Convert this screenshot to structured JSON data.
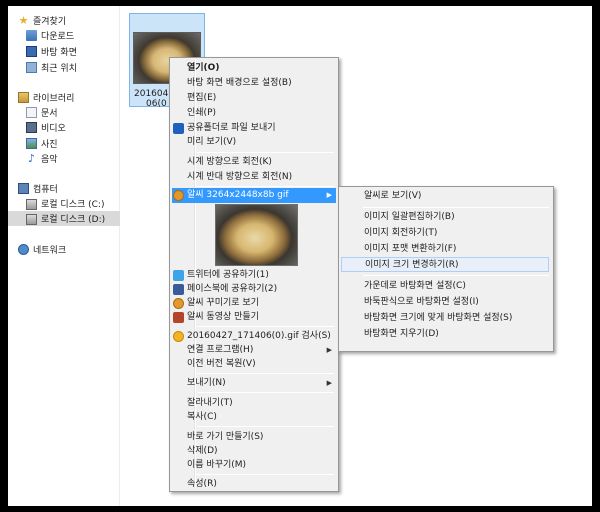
{
  "nav": {
    "favorites": {
      "label": "즐겨찾기",
      "items": [
        "다운로드",
        "바탕 화면",
        "최근 위치"
      ]
    },
    "libraries": {
      "label": "라이브러리",
      "items": [
        "문서",
        "비디오",
        "사진",
        "음악"
      ]
    },
    "computer": {
      "label": "컴퓨터",
      "items": [
        "로컬 디스크 (C:)",
        "로컬 디스크 (D:)"
      ]
    },
    "network": {
      "label": "네트워크"
    }
  },
  "file": {
    "name_line1": "2016042",
    "name_line2": "06(0"
  },
  "context_menu": {
    "items": [
      "열기(O)",
      "바탕 화면 배경으로 설정(B)",
      "편집(E)",
      "인쇄(P)",
      "공유폴더로 파일 보내기",
      "미리 보기(V)",
      "시계 방향으로 회전(K)",
      "시계 반대 방향으로 회전(N)",
      "알씨 3264x2448x8b gif",
      "트위터에 공유하기(1)",
      "페이스북에 공유하기(2)",
      "알씨 꾸미기로 보기",
      "알씨 동영상 만들기",
      "20160427_171406(0).gif 검사(S)",
      "연결 프로그램(H)",
      "이전 버전 복원(V)",
      "보내기(N)",
      "잘라내기(T)",
      "복사(C)",
      "바로 가기 만들기(S)",
      "삭제(D)",
      "이름 바꾸기(M)",
      "속성(R)"
    ]
  },
  "submenu": {
    "items": [
      "알씨로 보기(V)",
      "이미지 일괄편집하기(B)",
      "이미지 회전하기(T)",
      "이미지 포맷 변환하기(F)",
      "이미지 크기 변경하기(R)",
      "가운데로 바탕화면 설정(C)",
      "바둑판식으로 바탕화면 설정(I)",
      "바탕화면 크기에 맞게 바탕화면 설정(S)",
      "바탕화면 지우기(D)"
    ]
  }
}
